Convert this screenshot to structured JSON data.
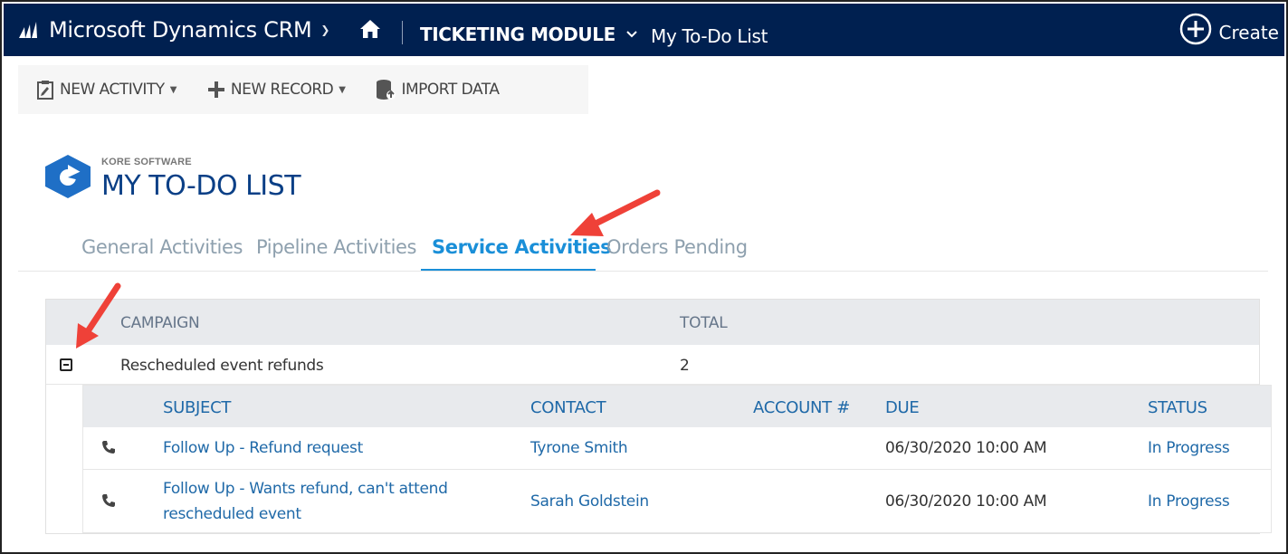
{
  "navbar": {
    "brand": "Microsoft Dynamics CRM",
    "module": "TICKETING MODULE",
    "page_link": "My To-Do List",
    "create_label": "Create"
  },
  "commands": [
    {
      "label": "NEW ACTIVITY",
      "icon": "clipboard-icon",
      "dropdown": true
    },
    {
      "label": "NEW RECORD",
      "icon": "plus-icon",
      "dropdown": true
    },
    {
      "label": "IMPORT DATA",
      "icon": "database-import-icon",
      "dropdown": false
    }
  ],
  "header": {
    "company": "KORE SOFTWARE",
    "title": "MY TO-DO LIST"
  },
  "tabs": [
    {
      "label": "General Activities",
      "active": false
    },
    {
      "label": "Pipeline Activities",
      "active": false
    },
    {
      "label": "Service Activities",
      "active": true
    },
    {
      "label": "Orders Pending",
      "active": false
    }
  ],
  "grid": {
    "columns": [
      "CAMPAIGN",
      "TOTAL"
    ],
    "group_row": {
      "campaign": "Rescheduled event refunds",
      "total": "2"
    },
    "sub_columns": [
      "SUBJECT",
      "CONTACT",
      "ACCOUNT #",
      "DUE",
      "STATUS"
    ],
    "sub_rows": [
      {
        "subject_line1": "Follow Up - Refund request",
        "subject_line2": "",
        "contact": "Tyrone Smith",
        "account": "",
        "due": "06/30/2020 10:00 AM",
        "status": "In Progress",
        "icon": "phone-icon"
      },
      {
        "subject_line1": "Follow Up - Wants refund, can't attend",
        "subject_line2": "rescheduled event",
        "contact": "Sarah Goldstein",
        "account": "",
        "due": "06/30/2020 10:00 AM",
        "status": "In Progress",
        "icon": "phone-icon"
      }
    ]
  },
  "colors": {
    "navbar": "#002050",
    "title": "#0a3f86",
    "tab_active": "#1a8fd8",
    "link": "#1f69a8",
    "annotation_arrow": "#ef4138"
  }
}
